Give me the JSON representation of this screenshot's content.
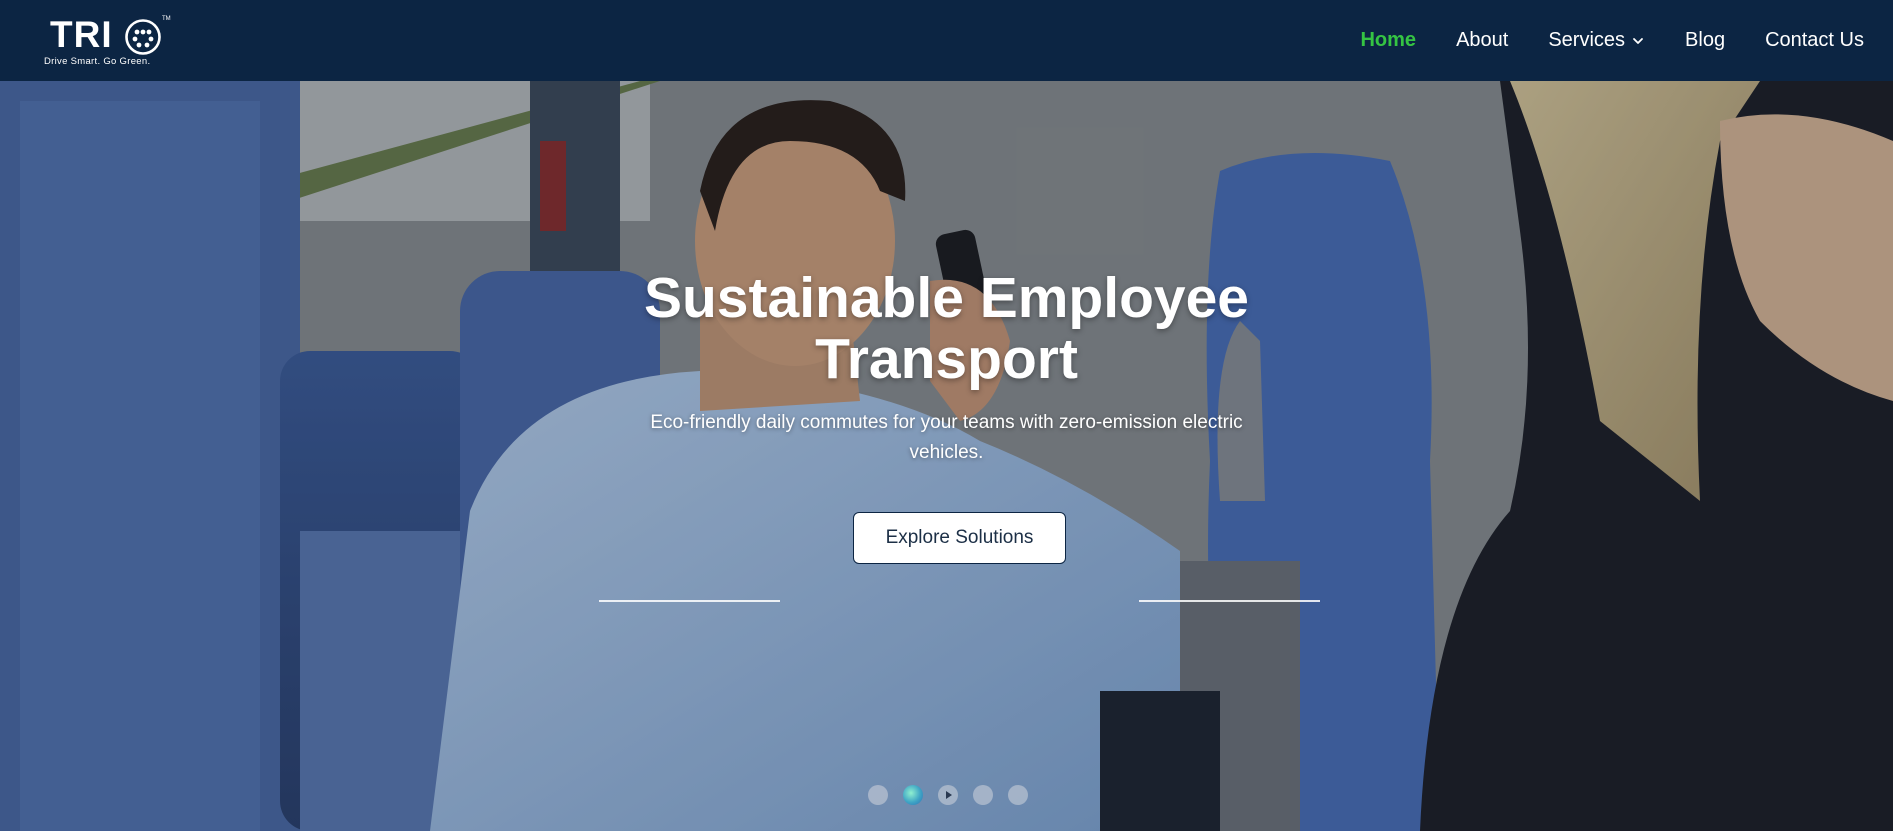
{
  "brand": {
    "name": "TRI",
    "trademark": "TM",
    "tagline": "Drive Smart. Go Green."
  },
  "nav": {
    "items": [
      {
        "label": "Home",
        "active": true
      },
      {
        "label": "About",
        "active": false
      },
      {
        "label": "Services",
        "active": false,
        "has_dropdown": true
      },
      {
        "label": "Blog",
        "active": false
      },
      {
        "label": "Contact Us",
        "active": false
      }
    ]
  },
  "hero": {
    "title": "Sustainable Employee Transport",
    "subtitle": "Eco-friendly daily commutes for your teams with zero-emission electric vehicles.",
    "cta_label": "Explore Solutions",
    "slides": {
      "count": 5,
      "active_index": 1
    }
  },
  "colors": {
    "header_bg": "#0c2543",
    "nav_active": "#35c443",
    "nav_text": "#ffffff",
    "cta_bg": "#ffffff",
    "cta_text": "#1c2f46"
  },
  "icons": {
    "logo_plug": "ev-plug-icon",
    "dropdown": "chevron-down-icon",
    "slider_play": "play-icon"
  }
}
